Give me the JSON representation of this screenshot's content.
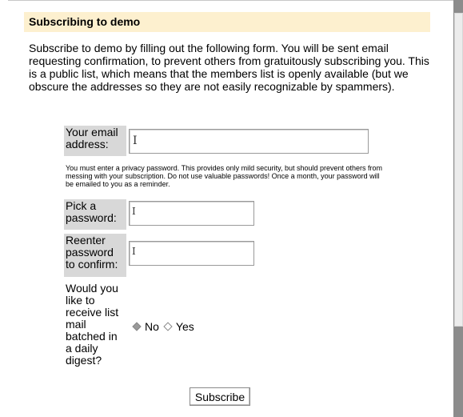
{
  "section": {
    "title": "Subscribing to demo",
    "intro": "Subscribe to demo by filling out the following form. You will be sent email requesting confirmation, to prevent others from gratuitously subscribing you. This is a public list, which means that the members list is openly available (but we obscure the addresses so they are not easily recognizable by spammers)."
  },
  "form": {
    "email_label": "Your email address:",
    "email_value": "",
    "password_note": "You must enter a privacy password. This provides only mild security, but should prevent others from messing with your subscription. Do not use valuable passwords! Once a month, your password will be emailed to you as a reminder.",
    "password_label": "Pick a password:",
    "confirm_label": "Reenter password to confirm:",
    "digest_label": "Would you like to receive list mail batched in a daily digest?",
    "digest_options": [
      "No",
      "Yes"
    ],
    "digest_selected": "No",
    "submit_label": "Subscribe"
  },
  "colors": {
    "header_bg": "#fdf0cf",
    "label_bg": "#d8d8d8"
  }
}
